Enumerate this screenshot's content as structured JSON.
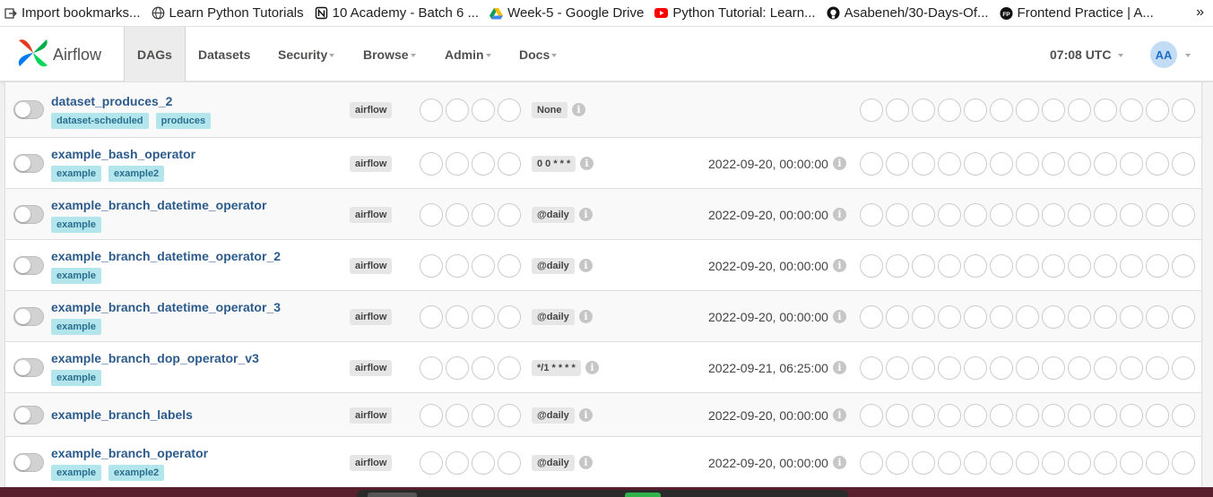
{
  "bookmarks": [
    {
      "label": "Import bookmarks...",
      "icon": "import-icon"
    },
    {
      "label": "Learn Python Tutorials",
      "icon": "globe-icon"
    },
    {
      "label": "10 Academy - Batch 6 ...",
      "icon": "notion-icon"
    },
    {
      "label": "Week-5 - Google Drive",
      "icon": "google-drive-icon"
    },
    {
      "label": "Python Tutorial: Learn...",
      "icon": "youtube-icon"
    },
    {
      "label": "Asabeneh/30-Days-Of...",
      "icon": "github-icon"
    },
    {
      "label": "Frontend Practice | A...",
      "icon": "fp-icon"
    }
  ],
  "bookmarks_more": "»",
  "navbar": {
    "brand": "Airflow",
    "items": [
      {
        "label": "DAGs",
        "active": true
      },
      {
        "label": "Datasets"
      },
      {
        "label": "Security"
      },
      {
        "label": "Browse"
      },
      {
        "label": "Admin"
      },
      {
        "label": "Docs"
      }
    ],
    "clock": "07:08 UTC",
    "avatar": "AA"
  },
  "info_glyph": "i",
  "dags": [
    {
      "name": "dataset_produces_2",
      "tags": [
        "dataset-scheduled",
        "produces"
      ],
      "owner": "airflow",
      "schedule": "None",
      "next_run": ""
    },
    {
      "name": "example_bash_operator",
      "tags": [
        "example",
        "example2"
      ],
      "owner": "airflow",
      "schedule": "0 0 * * *",
      "next_run": "2022-09-20, 00:00:00"
    },
    {
      "name": "example_branch_datetime_operator",
      "tags": [
        "example"
      ],
      "owner": "airflow",
      "schedule": "@daily",
      "next_run": "2022-09-20, 00:00:00"
    },
    {
      "name": "example_branch_datetime_operator_2",
      "tags": [
        "example"
      ],
      "owner": "airflow",
      "schedule": "@daily",
      "next_run": "2022-09-20, 00:00:00"
    },
    {
      "name": "example_branch_datetime_operator_3",
      "tags": [
        "example"
      ],
      "owner": "airflow",
      "schedule": "@daily",
      "next_run": "2022-09-20, 00:00:00"
    },
    {
      "name": "example_branch_dop_operator_v3",
      "tags": [
        "example"
      ],
      "owner": "airflow",
      "schedule": "*/1 * * * *",
      "next_run": "2022-09-21, 06:25:00"
    },
    {
      "name": "example_branch_labels",
      "tags": [],
      "owner": "airflow",
      "schedule": "@daily",
      "next_run": "2022-09-20, 00:00:00"
    },
    {
      "name": "example_branch_operator",
      "tags": [
        "example",
        "example2"
      ],
      "owner": "airflow",
      "schedule": "@daily",
      "next_run": "2022-09-20, 00:00:00"
    }
  ],
  "colors": {
    "dag_link": "#2c5b8c",
    "tag_bg": "#b3e5ec",
    "avatar_bg": "#c3dcf5"
  }
}
